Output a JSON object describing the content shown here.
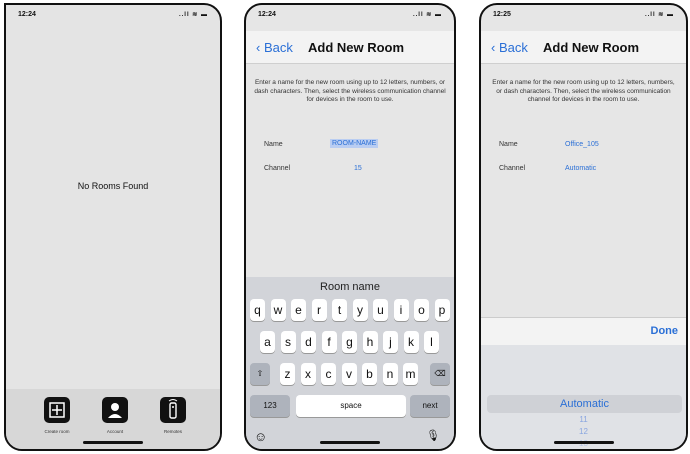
{
  "screen1": {
    "time": "12:24",
    "status_icons": "..ll ≋ ▬",
    "empty_message": "No Rooms Found",
    "tabs": [
      {
        "label": "Create room",
        "icon": "add-square-icon"
      },
      {
        "label": "Account",
        "icon": "person-icon"
      },
      {
        "label": "Remotes",
        "icon": "remote-icon"
      }
    ]
  },
  "screen2": {
    "time": "12:24",
    "status_icons": "..ll ≋ ▬",
    "back_label": "Back",
    "title": "Add New Room",
    "instructions": "Enter a name for the new room using up to 12 letters, numbers, or dash characters. Then, select the wireless communication channel for devices in the room to use.",
    "name_label": "Name",
    "name_value": "ROOM-NAME",
    "channel_label": "Channel",
    "channel_value": "15",
    "suggestion": "Room name",
    "row1": [
      "q",
      "w",
      "e",
      "r",
      "t",
      "y",
      "u",
      "i",
      "o",
      "p"
    ],
    "row2": [
      "a",
      "s",
      "d",
      "f",
      "g",
      "h",
      "j",
      "k",
      "l"
    ],
    "row3": [
      "z",
      "x",
      "c",
      "v",
      "b",
      "n",
      "m"
    ],
    "shift": "⇧",
    "backspace": "⌫",
    "numbers_key": "123",
    "space_key": "space",
    "next_key": "next",
    "emoji": "☺",
    "mic": "🎙"
  },
  "screen3": {
    "time": "12:25",
    "status_icons": "..ll ≋ ▬",
    "back_label": "Back",
    "title": "Add New Room",
    "instructions": "Enter a name for the new room using up to 12 letters, numbers, or dash characters. Then, select the wireless communication channel for devices in the room to use.",
    "name_label": "Name",
    "name_value": "Office_105",
    "channel_label": "Channel",
    "channel_value": "Automatic",
    "done_label": "Done",
    "picker_selected": "Automatic",
    "picker_options": [
      "11",
      "12",
      "13"
    ]
  },
  "colors": {
    "accent": "#2a6fd6",
    "selection": "#b9cdf2"
  }
}
